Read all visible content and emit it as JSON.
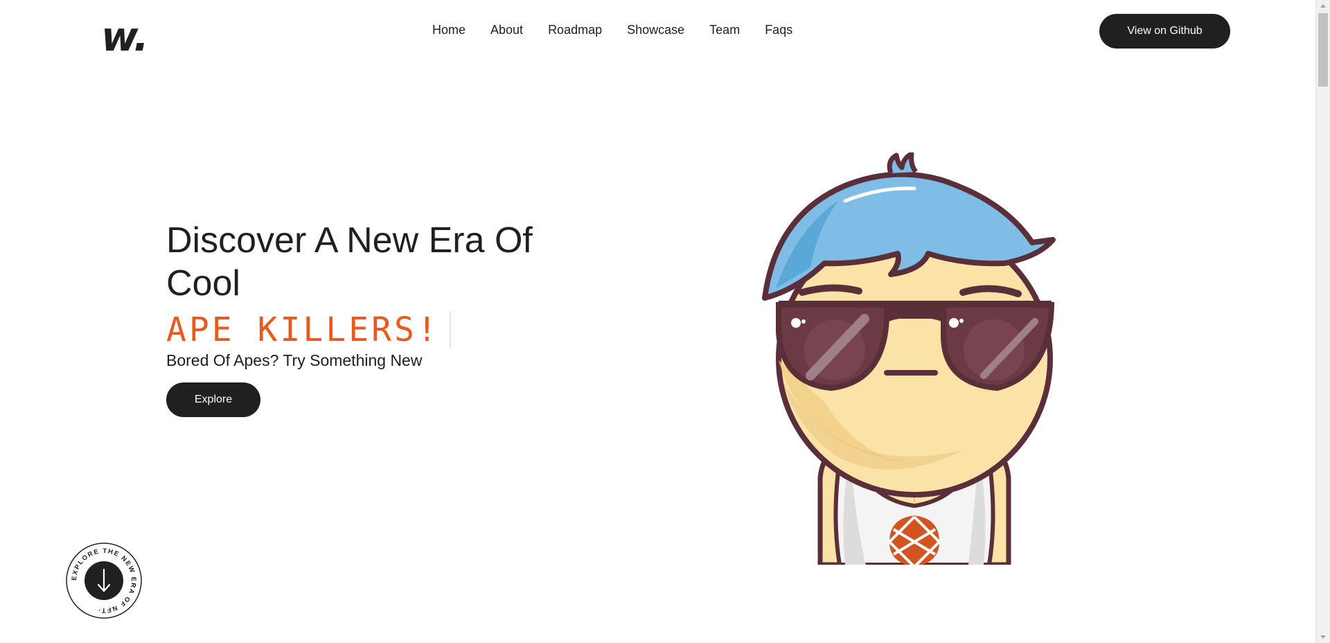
{
  "header": {
    "logo": "w.",
    "nav_items": [
      "Home",
      "About",
      "Roadmap",
      "Showcase",
      "Team",
      "Faqs"
    ],
    "github_button": "View on Github"
  },
  "hero": {
    "title": "Discover A New Era Of Cool",
    "typewriter_text": "APE KILLERS!",
    "subtitle": "Bored Of Apes? Try Something New",
    "explore_button": "Explore",
    "image_icon": "nft-character-blue-hair-sunglasses-icon"
  },
  "badge": {
    "circle_text": "EXPLORE THE NEW ERA OF NFT·",
    "icon": "arrow-down-icon"
  },
  "colors": {
    "primary": "#202020",
    "accent": "#e85a1f",
    "background": "#ffffff"
  }
}
